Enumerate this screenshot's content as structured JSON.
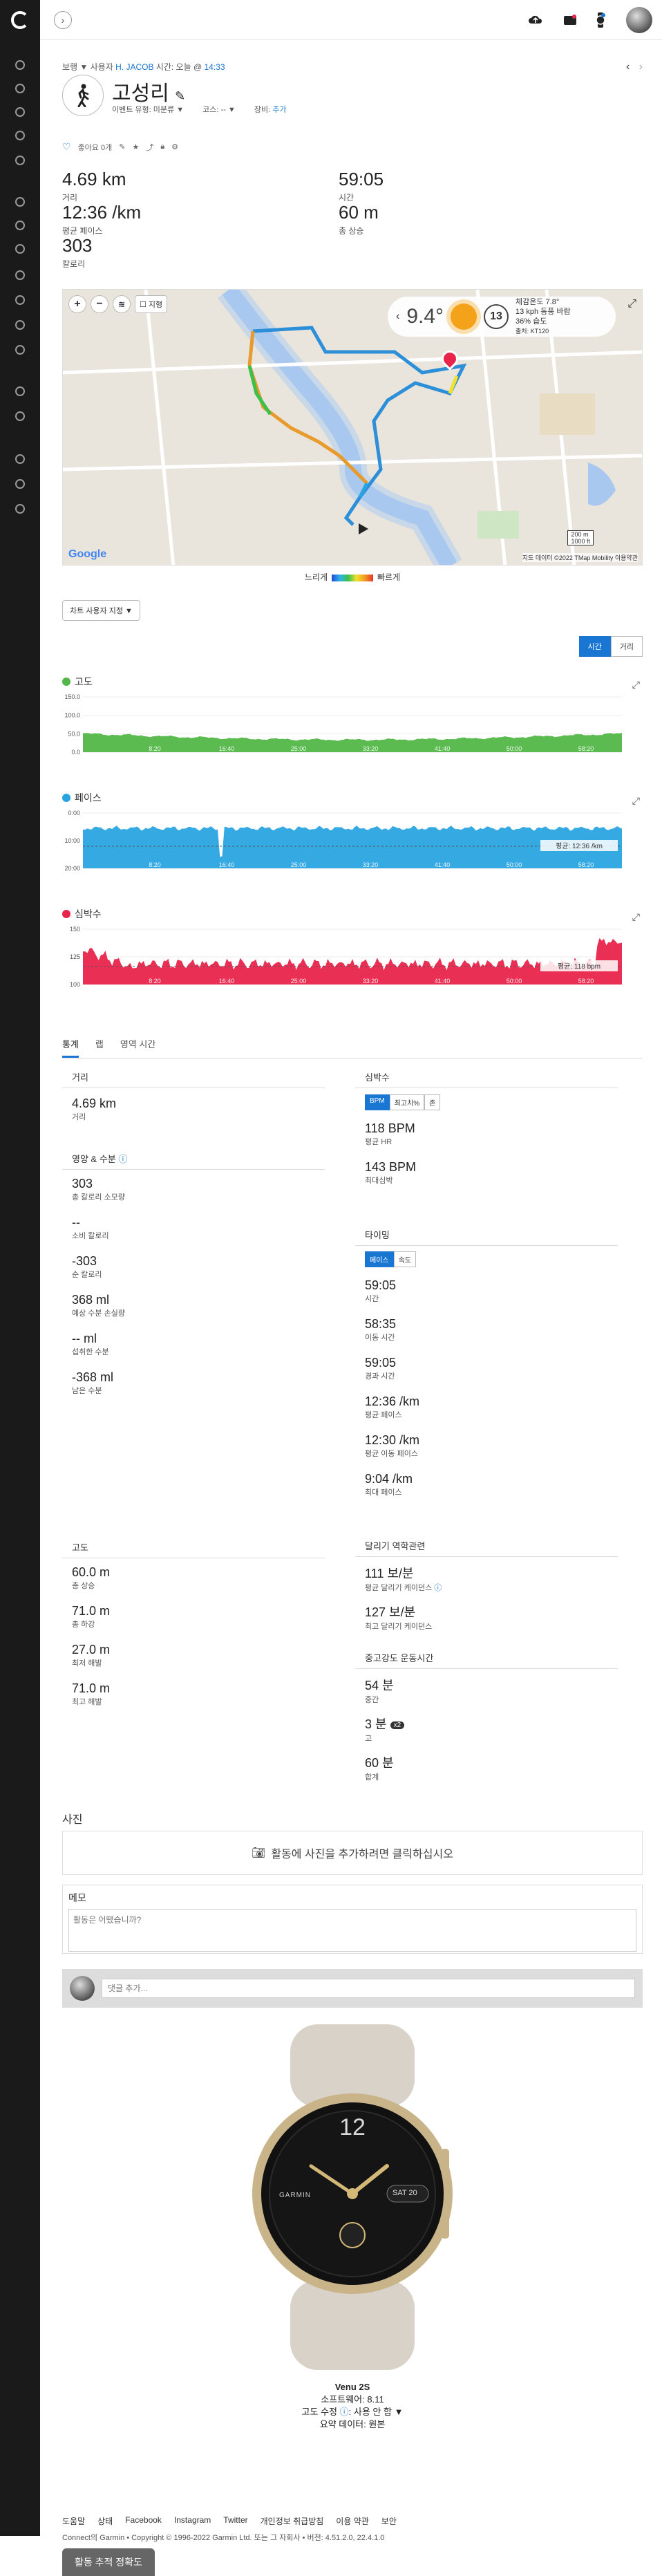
{
  "sidebar": {
    "items": [
      "dashboard-icon",
      "layers-icon",
      "trending-icon",
      "calendar-icon",
      "reports-icon",
      "activity-icon",
      "heart-icon",
      "running-icon",
      "target-icon",
      "dumbbell-icon",
      "pin-icon",
      "bar-chart-icon",
      "group-icon",
      "trophy-icon",
      "gear-icon",
      "medal-icon",
      "help-icon"
    ]
  },
  "topbar": {
    "icons": [
      "upload-icon",
      "inbox-icon",
      "watch-icon"
    ]
  },
  "breadcrumb": {
    "type": "보행",
    "owner_label": "사용자",
    "owner": "H. JACOB",
    "time_label": "시간: 오늘 @",
    "time": "14:33"
  },
  "activity": {
    "title": "고성리",
    "event_type_label": "이벤트 유형:",
    "event_type": "미분류",
    "course_label": "코스:",
    "course": "--",
    "gear_label": "장비:",
    "gear": "추가",
    "like_label": "좋아요 0개"
  },
  "summary": [
    {
      "value": "4.69 km",
      "label": "거리"
    },
    {
      "value": "59:05",
      "label": "시간"
    },
    {
      "value": "12:36 /km",
      "label": "평균 페이스"
    },
    {
      "value": "60 m",
      "label": "총 상승"
    },
    {
      "value": "303",
      "label": "칼로리"
    }
  ],
  "map": {
    "temperature": "9.4°",
    "wind_speed": "13",
    "weather_lines": [
      "체감온도 7.8°",
      "13 kph 동풍 바람",
      "36% 습도",
      "출처: KT120"
    ],
    "controls": [
      "zoom-in",
      "zoom-out",
      "layers",
      "지형"
    ],
    "google": "Google",
    "copyright": "지도 데이터 ©2022 TMap Mobility",
    "terms": "이용약관",
    "scale1": "200 m",
    "scale2": "1000 ft"
  },
  "legend": {
    "slow": "느리게",
    "fast": "빠르게"
  },
  "map_custom": "차트 사용자 지정 ▼",
  "view_toggle": {
    "time": "시간",
    "distance": "거리"
  },
  "charts": {
    "elevation": {
      "title": "고도",
      "color": "#52b748",
      "ticks": [
        "150.0",
        "100.0",
        "50.0",
        "0.0"
      ],
      "xticks": [
        "8:20",
        "16:40",
        "25:00",
        "33:20",
        "41:40",
        "50:00",
        "58:20"
      ]
    },
    "pace": {
      "title": "페이스",
      "color": "#2aa4e0",
      "ticks": [
        "0:00",
        "10:00",
        "20:00"
      ],
      "avg": "평균: 12:36 /km",
      "xticks": [
        "8:20",
        "16:40",
        "25:00",
        "33:20",
        "41:40",
        "50:00",
        "58:20"
      ]
    },
    "heart": {
      "title": "심박수",
      "color": "#e8244a",
      "ticks": [
        "150",
        "125",
        "100"
      ],
      "avg": "평균: 118 bpm",
      "xticks": [
        "8:20",
        "16:40",
        "25:00",
        "33:20",
        "41:40",
        "50:00",
        "58:20"
      ]
    }
  },
  "tabs": [
    "통계",
    "랩",
    "영역 시간"
  ],
  "stats": {
    "distance": {
      "title": "거리",
      "value": "4.69 km",
      "label": "거리"
    },
    "nutrition": {
      "title": "영양 & 수분",
      "rows": [
        {
          "v": "303",
          "l": "총 칼로리 소모량"
        },
        {
          "v": "--",
          "l": "소비 칼로리"
        },
        {
          "v": "-303",
          "l": "순 칼로리"
        },
        {
          "v": "368 ml",
          "l": "예상 수분 손실량"
        },
        {
          "v": "-- ml",
          "l": "섭취한 수분"
        },
        {
          "v": "-368 ml",
          "l": "남은 수분"
        }
      ]
    },
    "elev": {
      "title": "고도",
      "rows": [
        {
          "v": "60.0 m",
          "l": "총 상승"
        },
        {
          "v": "71.0 m",
          "l": "총 하강"
        },
        {
          "v": "27.0 m",
          "l": "최저 해발"
        },
        {
          "v": "71.0 m",
          "l": "최고 해발"
        }
      ]
    },
    "heart": {
      "title": "심박수",
      "pills": [
        "BPM",
        "최고치%",
        "존"
      ],
      "rows": [
        {
          "v": "118 BPM",
          "l": "평균 HR"
        },
        {
          "v": "143 BPM",
          "l": "최대심박"
        }
      ]
    },
    "timing": {
      "title": "타이밍",
      "pills": [
        "페이스",
        "속도"
      ],
      "rows": [
        {
          "v": "59:05",
          "l": "시간"
        },
        {
          "v": "58:35",
          "l": "이동 시간"
        },
        {
          "v": "59:05",
          "l": "경과 시간"
        },
        {
          "v": "12:36 /km",
          "l": "평균 페이스"
        },
        {
          "v": "12:30 /km",
          "l": "평균 이동 페이스"
        },
        {
          "v": "9:04 /km",
          "l": "최대 페이스"
        }
      ]
    },
    "cadence": {
      "title": "달리기 역학관련",
      "rows": [
        {
          "v": "111 보/분",
          "l": "평균 달리기 케이던스"
        },
        {
          "v": "127 보/분",
          "l": "최고 달리기 케이던스"
        }
      ]
    },
    "intensity": {
      "title": "중고강도 운동시간",
      "rows": [
        {
          "v": "54 분",
          "l": "중간"
        },
        {
          "v": "3 분",
          "l": "고",
          "badge": "x2"
        },
        {
          "v": "60 분",
          "l": "합계"
        }
      ]
    }
  },
  "photos": {
    "title": "사진",
    "cta": "활동에 사진을 추가하려면 클릭하십시오"
  },
  "memo": {
    "title": "메모",
    "placeholder": "활동은 어땠습니까?"
  },
  "comment": {
    "placeholder": "댓글 추가..."
  },
  "device": {
    "name": "Venu 2S",
    "firmware": "소프트웨어: 8.11",
    "elev_corr_label": "고도 수정",
    "elev_corr": "사용 안 함",
    "summary_label": "요약 데이터:",
    "summary": "원본",
    "watch_brand": "GARMIN",
    "watch_date": "SAT 20"
  },
  "footer": {
    "links": [
      "도움말",
      "상태",
      "Facebook",
      "Instagram",
      "Twitter",
      "개인정보 취급방침",
      "이용 약관",
      "보안"
    ],
    "copyright": "Connect의 Garmin • Copyright © 1996-2022 Garmin Ltd. 또는 그 자회사 • 버전: 4.51.2.0, 22.4.1.0",
    "accuracy_button": "활동 추적 정확도"
  }
}
